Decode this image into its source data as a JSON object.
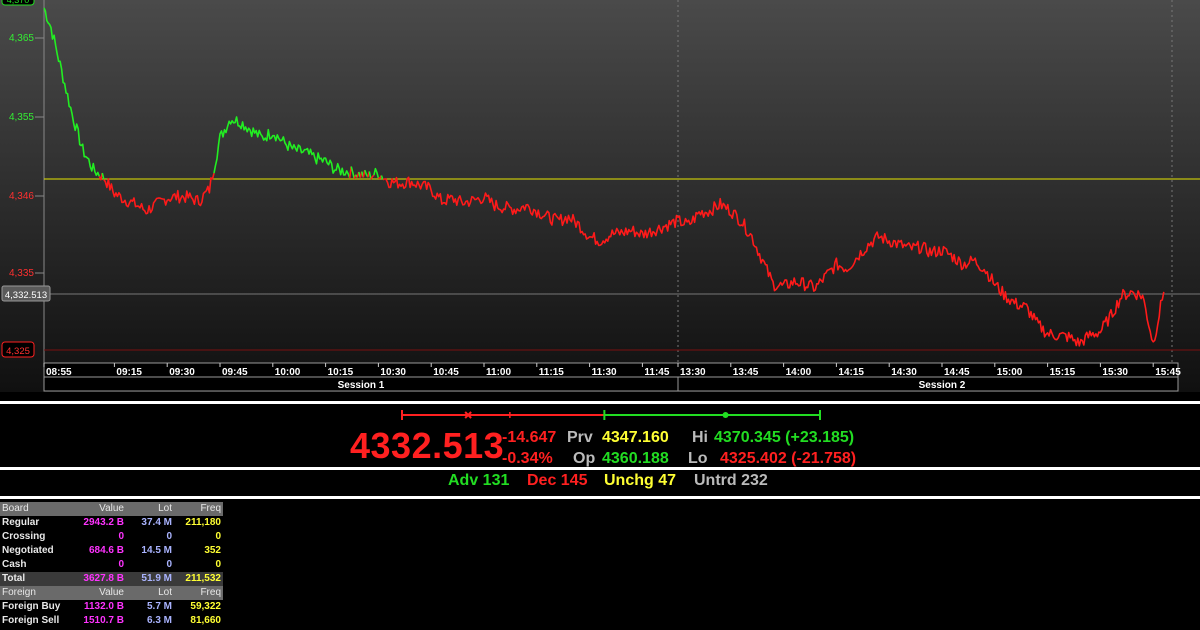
{
  "chart_data": {
    "type": "line",
    "title": "",
    "xlabel": "",
    "ylabel": "",
    "ylim": [
      4323.5,
      4369.5
    ],
    "y_ticks": [
      "4,365",
      "4,355",
      "4,346",
      "4,335",
      "4,325"
    ],
    "x_ticks": [
      "08:55",
      "09:15",
      "09:30",
      "09:45",
      "10:00",
      "10:15",
      "10:30",
      "10:45",
      "11:00",
      "11:15",
      "11:30",
      "11:45",
      "13:30",
      "13:45",
      "14:00",
      "14:15",
      "14:30",
      "14:45",
      "15:00",
      "15:15",
      "15:30",
      "15:45"
    ],
    "sessions": [
      "Session 1",
      "Session 2"
    ],
    "reference_line": {
      "value": 4347.16,
      "color": "#e6e600"
    },
    "last_line": {
      "value": 4332.513,
      "label": "4,332.513"
    },
    "low_line": {
      "value": 4325.402,
      "label": "4,325"
    },
    "top_label": "4,370",
    "series": [
      {
        "color_above": "#22ee22",
        "color_below": "#ff1a1a",
        "x": [
          "08:55",
          "08:57",
          "09:00",
          "09:03",
          "09:06",
          "09:09",
          "09:12",
          "09:15",
          "09:18",
          "09:21",
          "09:24",
          "09:27",
          "09:30",
          "09:33",
          "09:36",
          "09:39",
          "09:42",
          "09:45",
          "09:48",
          "09:51",
          "09:54",
          "09:57",
          "10:00",
          "10:03",
          "10:06",
          "10:09",
          "10:12",
          "10:15",
          "10:18",
          "10:21",
          "10:24",
          "10:27",
          "10:30",
          "10:33",
          "10:36",
          "10:39",
          "10:42",
          "10:45",
          "10:48",
          "10:51",
          "10:54",
          "10:57",
          "11:00",
          "11:03",
          "11:06",
          "11:09",
          "11:12",
          "11:15",
          "11:18",
          "11:21",
          "11:24",
          "11:27",
          "11:30",
          "11:33",
          "11:36",
          "11:39",
          "11:42",
          "11:45",
          "11:48",
          "13:30",
          "13:33",
          "13:36",
          "13:39",
          "13:42",
          "13:45",
          "13:48",
          "13:51",
          "13:54",
          "13:57",
          "14:00",
          "14:03",
          "14:06",
          "14:09",
          "14:12",
          "14:15",
          "14:18",
          "14:21",
          "14:24",
          "14:27",
          "14:30",
          "14:33",
          "14:36",
          "14:39",
          "14:42",
          "14:45",
          "14:48",
          "14:51",
          "14:54",
          "14:57",
          "15:00",
          "15:03",
          "15:06",
          "15:09",
          "15:12",
          "15:15",
          "15:18",
          "15:21",
          "15:24",
          "15:27",
          "15:30",
          "15:33",
          "15:36",
          "15:39",
          "15:42",
          "15:45",
          "15:48"
        ],
        "values": [
          4368.5,
          4366.0,
          4360.5,
          4355.0,
          4350.5,
          4348.0,
          4347.0,
          4345.0,
          4344.2,
          4343.6,
          4342.8,
          4343.6,
          4344.4,
          4344.6,
          4344.5,
          4344.0,
          4345.5,
          4352.0,
          4354.5,
          4354.0,
          4353.0,
          4352.0,
          4352.8,
          4351.5,
          4350.5,
          4350.2,
          4349.5,
          4349.0,
          4348.0,
          4347.8,
          4347.5,
          4347.2,
          4347.6,
          4346.5,
          4346.3,
          4346.5,
          4346.0,
          4345.5,
          4344.0,
          4344.3,
          4343.8,
          4344.1,
          4344.5,
          4343.5,
          4343.2,
          4343.0,
          4343.4,
          4342.8,
          4342.0,
          4341.5,
          4342.0,
          4341.0,
          4339.5,
          4339.0,
          4339.8,
          4340.0,
          4340.3,
          4339.8,
          4340.3,
          4341.5,
          4341.0,
          4342.5,
          4342.8,
          4343.6,
          4342.8,
          4341.5,
          4339.5,
          4336.5,
          4333.5,
          4333.2,
          4333.8,
          4333.5,
          4333.0,
          4334.5,
          4336.0,
          4335.5,
          4337.0,
          4338.5,
          4339.5,
          4339.0,
          4338.5,
          4338.0,
          4338.2,
          4337.5,
          4337.8,
          4337.0,
          4336.0,
          4336.5,
          4335.5,
          4333.5,
          4332.0,
          4331.0,
          4330.5,
          4328.5,
          4327.2,
          4327.0,
          4326.8,
          4326.0,
          4327.0,
          4327.5,
          4329.5,
          4332.0,
          4332.5,
          4332.0,
          4326.0,
          4332.513
        ]
      }
    ]
  },
  "range_bar": {
    "low": 4325.402,
    "prev": 4347.16,
    "open": 4360.188,
    "high": 4370.345
  },
  "summary": {
    "last": "4332.513",
    "change": "-14.647",
    "change_pct": "-0.34%",
    "prv_label": "Prv",
    "prv_value": "4347.160",
    "op_label": "Op",
    "op_value": "4360.188",
    "hi_label": "Hi",
    "hi_value": "4370.345 (+23.185)",
    "lo_label": "Lo",
    "lo_value": "4325.402 (-21.758)",
    "adv": "Adv 131",
    "dec": "Dec 145",
    "unchg": "Unchg 47",
    "untrd": "Untrd 232"
  },
  "board": {
    "headers": [
      "Board",
      "Value",
      "Lot",
      "Freq"
    ],
    "rows": [
      {
        "label": "Regular",
        "value": "2943.2 B",
        "lot": "37.4 M",
        "freq": "211,180"
      },
      {
        "label": "Crossing",
        "value": "0",
        "lot": "0",
        "freq": "0"
      },
      {
        "label": "Negotiated",
        "value": "684.6 B",
        "lot": "14.5 M",
        "freq": "352"
      },
      {
        "label": "Cash",
        "value": "0",
        "lot": "0",
        "freq": "0"
      }
    ],
    "total": {
      "label": "Total",
      "value": "3627.8 B",
      "lot": "51.9 M",
      "freq": "211,532"
    },
    "foreign_headers": [
      "Foreign",
      "Value",
      "Lot",
      "Freq"
    ],
    "foreign_rows": [
      {
        "label": "Foreign Buy",
        "value": "1132.0 B",
        "lot": "5.7 M",
        "freq": "59,322"
      },
      {
        "label": "Foreign Sell",
        "value": "1510.7 B",
        "lot": "6.3 M",
        "freq": "81,660"
      }
    ]
  }
}
